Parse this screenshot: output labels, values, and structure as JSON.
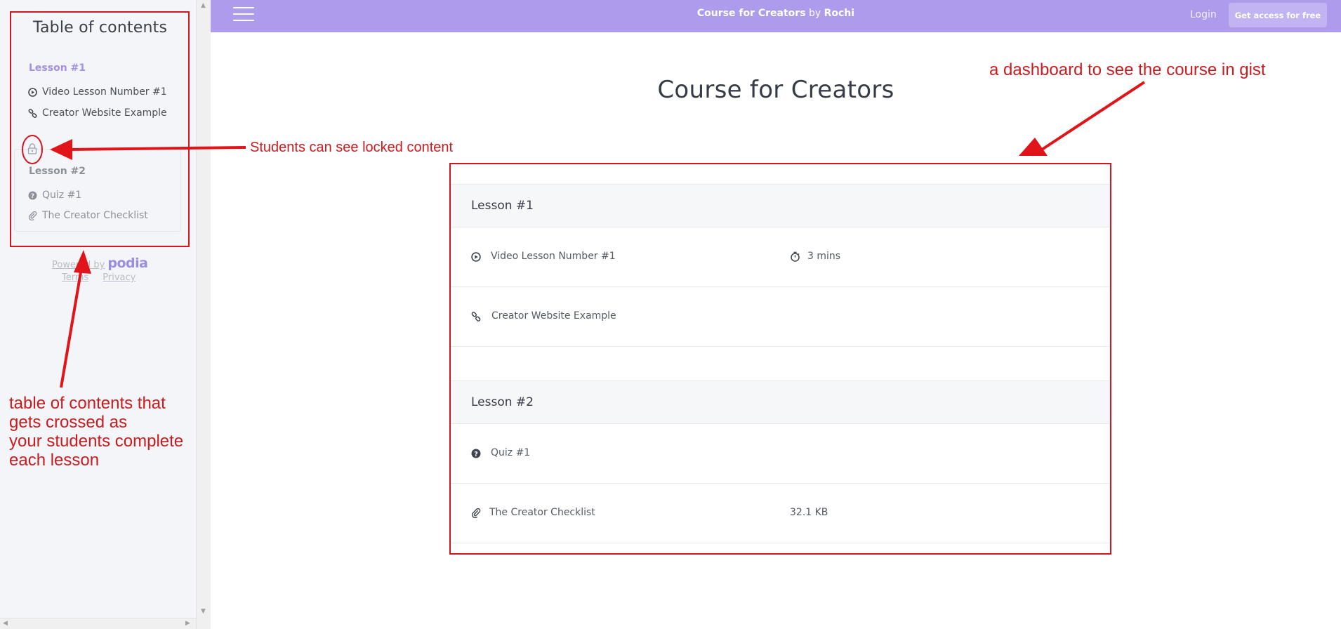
{
  "sidebar": {
    "title": "Table of contents",
    "lessons": [
      {
        "label": "Lesson #1",
        "items": [
          {
            "label": "Video Lesson Number #1",
            "icon": "play-circle-icon"
          },
          {
            "label": "Creator Website Example",
            "icon": "link-icon"
          }
        ]
      },
      {
        "label": "Lesson #2",
        "locked": true,
        "items": [
          {
            "label": "Quiz #1",
            "icon": "question-circle-icon"
          },
          {
            "label": "The Creator Checklist",
            "icon": "paperclip-icon"
          }
        ]
      }
    ],
    "powered_by": "Powered by",
    "logo": "podia",
    "terms": "Terms",
    "privacy": "Privacy"
  },
  "nav": {
    "course_name": "Course for Creators",
    "by": "by",
    "author": "Rochi",
    "login": "Login",
    "cta": "Get access for free"
  },
  "main": {
    "title": "Course for Creators",
    "lessons": [
      {
        "label": "Lesson #1",
        "items": [
          {
            "label": "Video Lesson Number #1",
            "icon": "play-circle-icon",
            "meta": "3 mins",
            "meta_icon": "stopwatch-icon"
          },
          {
            "label": "Creator Website Example",
            "icon": "link-icon",
            "meta": ""
          }
        ]
      },
      {
        "label": "Lesson #2",
        "items": [
          {
            "label": "Quiz #1",
            "icon": "question-circle-icon",
            "meta": ""
          },
          {
            "label": "The Creator Checklist",
            "icon": "paperclip-icon",
            "meta": "32.1 KB"
          }
        ]
      }
    ]
  },
  "annotations": {
    "locked": "Students can see locked content",
    "dashboard": "a dashboard to see the course in gist",
    "toc_lines": [
      "table of contents that",
      "gets crossed as",
      "your students complete",
      "each lesson"
    ]
  },
  "colors": {
    "nav_bg": "#ae9bec",
    "accent": "#9b8de0",
    "annotation_red": "#d4151d"
  }
}
